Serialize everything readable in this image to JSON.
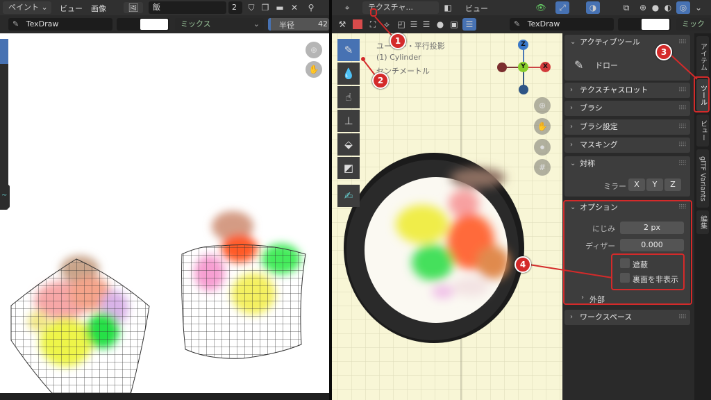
{
  "left": {
    "mode": "ペイント",
    "menu": [
      "ビュー",
      "画像"
    ],
    "image_name": "飯",
    "user_count": "2",
    "brush_name": "TexDraw",
    "blend": "ミックス",
    "radius_label": "半径",
    "radius_value": "42"
  },
  "right": {
    "editor": "テクスチャ...",
    "menu_view": "ビュー",
    "brush_name": "TexDraw",
    "blend": "ミックス",
    "overlay_lines": [
      "ユーザー・平行投影",
      "(1) Cylinder",
      "センチメートル"
    ],
    "gizmo": {
      "z": "Z",
      "y": "Y",
      "x": "X"
    }
  },
  "sidebar": {
    "active_tool": {
      "title": "アクティブツール",
      "tool": "ドロー"
    },
    "sections": [
      "テクスチャスロット",
      "ブラシ",
      "ブラシ設定",
      "マスキング"
    ],
    "symmetry": {
      "title": "対称",
      "mirror_label": "ミラー",
      "axes": [
        "X",
        "Y",
        "Z"
      ]
    },
    "options": {
      "title": "オプション",
      "bleed_label": "にじみ",
      "bleed_value": "2 px",
      "dither_label": "ディザー",
      "dither_value": "0.000",
      "occlude": "遮蔽",
      "backface": "裏面を非表示",
      "external": "外部"
    },
    "workspace": "ワークスペース"
  },
  "tabs": [
    "アイテム",
    "ツール",
    "ビュー",
    "glTF Variants",
    "編集"
  ],
  "markers": [
    "1",
    "2",
    "3",
    "4"
  ],
  "colors": {
    "accent": "#4772b3",
    "marker": "#d42a2a",
    "viewport": "#f8f6d6"
  }
}
